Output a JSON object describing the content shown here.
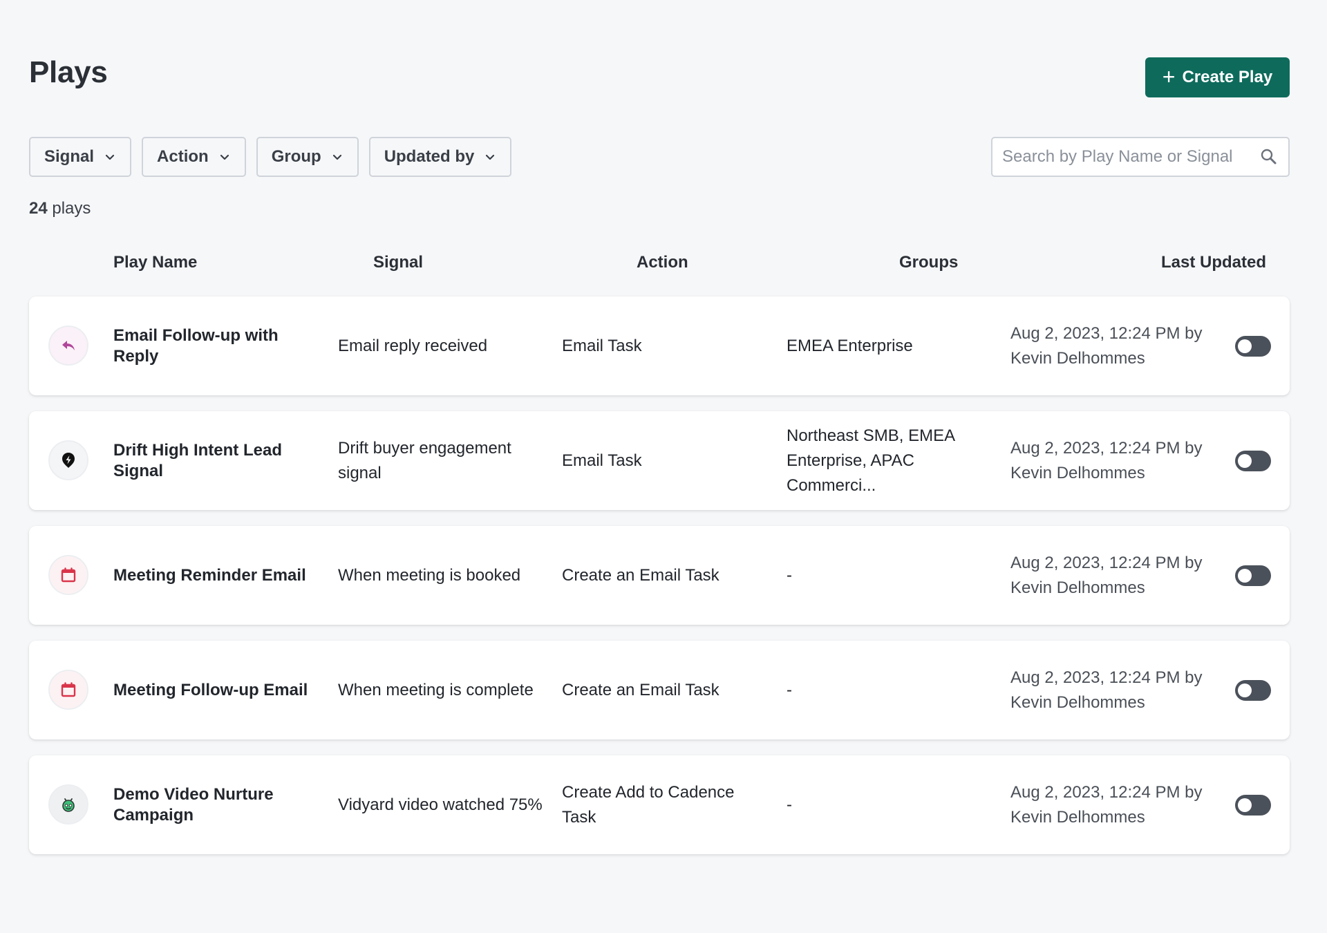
{
  "header": {
    "title": "Plays",
    "create_button": "Create Play"
  },
  "filters": [
    {
      "label": "Signal"
    },
    {
      "label": "Action"
    },
    {
      "label": "Group"
    },
    {
      "label": "Updated by"
    }
  ],
  "search": {
    "placeholder": "Search by Play Name or Signal",
    "value": ""
  },
  "summary": {
    "count": "24",
    "count_label": "plays"
  },
  "table": {
    "columns": {
      "play_name": "Play Name",
      "signal": "Signal",
      "action": "Action",
      "groups": "Groups",
      "last_updated": "Last Updated"
    },
    "rows": [
      {
        "icon": "reply-icon",
        "name": "Email Follow-up with Reply",
        "signal": "Email reply received",
        "action": "Email Task",
        "groups": "EMEA Enterprise",
        "updated": "Aug 2, 2023, 12:24 PM by Kevin Delhommes",
        "enabled": false
      },
      {
        "icon": "drift-icon",
        "name": "Drift High Intent Lead Signal",
        "signal": "Drift buyer engagement signal",
        "action": "Email Task",
        "groups": "Northeast SMB, EMEA Enterprise, APAC Commerci...",
        "updated": "Aug 2, 2023, 12:24 PM by Kevin Delhommes",
        "enabled": false
      },
      {
        "icon": "calendar-icon",
        "name": "Meeting Reminder Email",
        "signal": "When meeting is booked",
        "action": "Create an Email Task",
        "groups": "-",
        "updated": "Aug 2, 2023, 12:24 PM by Kevin Delhommes",
        "enabled": false
      },
      {
        "icon": "calendar-icon",
        "name": "Meeting Follow-up Email",
        "signal": "When meeting is complete",
        "action": "Create an Email Task",
        "groups": "-",
        "updated": "Aug 2, 2023, 12:24 PM by Kevin Delhommes",
        "enabled": false
      },
      {
        "icon": "vidyard-icon",
        "name": "Demo Video Nurture Campaign",
        "signal": "Vidyard video watched 75%",
        "action": "Create Add to Cadence Task",
        "groups": "-",
        "updated": "Aug 2, 2023, 12:24 PM by Kevin Delhommes",
        "enabled": false
      }
    ]
  },
  "colors": {
    "primary": "#0e6b5c",
    "background": "#f6f7f9",
    "toggle_off": "#4b515a",
    "reply_accent": "#b0479a",
    "calendar_accent": "#d9344a",
    "vidyard_accent": "#3fc07a"
  }
}
